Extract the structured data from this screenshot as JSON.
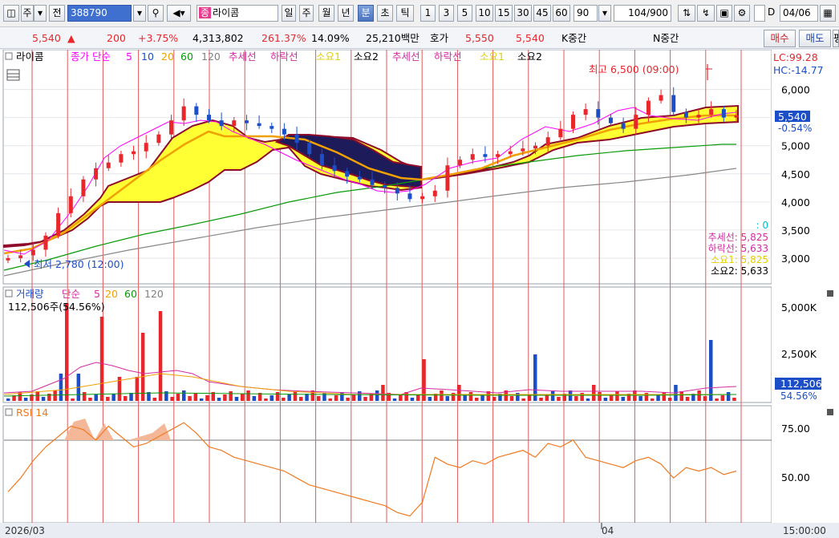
{
  "toolbar": {
    "item1": "주",
    "item2": "전",
    "stock_code": "388790",
    "stock_tag": "종",
    "stock_name": "라이콤",
    "periods": [
      "일",
      "주",
      "월",
      "년",
      "분",
      "초",
      "틱"
    ],
    "active_period": "분",
    "intervals": [
      "1",
      "3",
      "5",
      "10",
      "15",
      "30",
      "45",
      "60"
    ],
    "interval_value": "90",
    "count": "104",
    "count_max": "/900",
    "checkbox_label": "D",
    "date": "04/06"
  },
  "quote": {
    "price": "5,540",
    "change": "200",
    "change_pct": "+3.75%",
    "volume": "4,313,802",
    "vol_ratio": "261.37%",
    "turnover": "14.09%",
    "amount": "25,210백만",
    "ask_label": "호가",
    "ask": "5,550",
    "bid": "5,540",
    "k_label": "K중간",
    "n_label": "N중간",
    "buy_label": "매수",
    "sell_label": "매도",
    "eval_label": "평"
  },
  "price_panel": {
    "title": "라이콤",
    "legend_ma": "종가 단순",
    "ma_periods": [
      "5",
      "10",
      "20",
      "60",
      "120"
    ],
    "legend_ichimoku": [
      "추세선",
      "하락선",
      "소요1",
      "소요2",
      "추세선",
      "하락선",
      "소요1",
      "소요2"
    ],
    "lc": "LC:99.28",
    "hc": "HC:-14.77",
    "high_label": "최고 6,500 (09:00)",
    "low_label": "최저 2,780 (12:00)",
    "last_price": "5,540",
    "last_pct": "-0.54%",
    "zero_label": ": 0",
    "ichimoku_values": [
      "추세선: 5,825",
      "하락선: 5,633",
      "소요1: 5,825",
      "소요2: 5,633"
    ],
    "y_ticks": [
      "6,000",
      "5,500",
      "5,000",
      "4,500",
      "4,000",
      "3,500",
      "3,000"
    ]
  },
  "volume_panel": {
    "title": "거래량",
    "legend_ma": "단순",
    "ma_periods": [
      "5",
      "20",
      "60",
      "120"
    ],
    "info": "112,506주(54.56%)",
    "last": "112,506",
    "last_pct": "54.56%",
    "y_ticks": [
      "5,000K",
      "2,500K"
    ]
  },
  "rsi_panel": {
    "title": "RSI 14",
    "y_ticks": [
      "75.00",
      "50.00"
    ]
  },
  "x_axis": {
    "start": "2026/03",
    "mid": "04",
    "time": "15:00:00"
  },
  "chart_data": {
    "type": "candlestick",
    "price_range": [
      2600,
      6650
    ],
    "high": 6500,
    "low": 2780,
    "last": 5540,
    "close_approx": [
      3000,
      3050,
      3150,
      3400,
      3800,
      4100,
      4400,
      4600,
      4700,
      4850,
      4900,
      5050,
      5200,
      5450,
      5700,
      5550,
      5450,
      5350,
      5450,
      5400,
      5350,
      5300,
      5200,
      5050,
      4850,
      4650,
      4550,
      4450,
      4400,
      4300,
      4250,
      4150,
      4050,
      4100,
      4200,
      4650,
      4750,
      4850,
      4800,
      4850,
      4900,
      4950,
      5000,
      5150,
      5300,
      5550,
      5650,
      5500,
      5400,
      5300,
      5550,
      5800,
      5900,
      5600,
      5500,
      5550,
      5650,
      5500,
      5540
    ],
    "rsi_range": [
      25,
      90
    ],
    "rsi_levels": [
      70,
      30
    ]
  },
  "colors": {
    "up": "#e8262b",
    "down": "#1c4fc7",
    "cloud_bull": "#ffff33",
    "cloud_bear": "#1e1b5a",
    "ma5": "#ff00ff",
    "ma20": "#f0a000",
    "ma60": "#0a9a0a",
    "ma120": "#808080"
  }
}
